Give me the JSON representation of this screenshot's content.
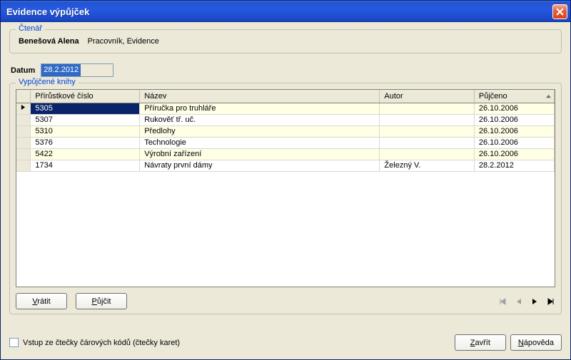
{
  "window": {
    "title": "Evidence výpůjček"
  },
  "reader": {
    "legend": "Čtenář",
    "name": "Benešová Alena",
    "detail": "Pracovník, Evidence"
  },
  "date": {
    "label": "Datum",
    "value": "28.2.2012"
  },
  "books": {
    "legend": "Vypůjčené knihy",
    "headers": {
      "number": "Přírůstkové číslo",
      "title": "Název",
      "author": "Autor",
      "loaned": "Půjčeno"
    },
    "rows": [
      {
        "number": "5305",
        "title": "Příručka pro truhláře",
        "author": "",
        "loaned": "26.10.2006"
      },
      {
        "number": "5307",
        "title": "Rukověť tř. uč.",
        "author": "",
        "loaned": "26.10.2006"
      },
      {
        "number": "5310",
        "title": "Předlohy",
        "author": "",
        "loaned": "26.10.2006"
      },
      {
        "number": "5376",
        "title": "Technologie",
        "author": "",
        "loaned": "26.10.2006"
      },
      {
        "number": "5422",
        "title": "Výrobní zařízení",
        "author": "",
        "loaned": "26.10.2006"
      },
      {
        "number": "1734",
        "title": "Návraty první dámy",
        "author": "Železný V.",
        "loaned": "28.2.2012"
      }
    ]
  },
  "buttons": {
    "return": "Vrátit",
    "lend": "Půjčit",
    "close": "Zavřít",
    "help": "Nápověda"
  },
  "checkbox": {
    "label": "Vstup ze čtečky čárových kódů (čtečky karet)",
    "checked": false
  }
}
